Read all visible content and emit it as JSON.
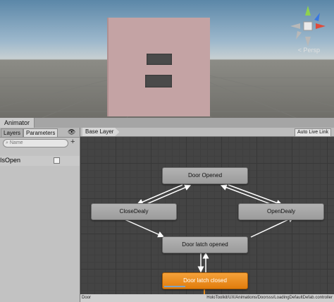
{
  "scene": {
    "persp_label": "< Persp"
  },
  "animator": {
    "window_title": "Animator",
    "left_tabs": [
      "Layers",
      "Parameters"
    ],
    "eye_icon": "eye-icon",
    "search_placeholder": "Name",
    "add_label": "+",
    "parameters": [
      {
        "name": "IsOpen",
        "type": "bool",
        "value": false
      }
    ],
    "layer_breadcrumb": "Base Layer",
    "auto_live_link": "Auto Live Link",
    "states": [
      "Door Opened",
      "CloseDealy",
      "OpenDealy",
      "Door latch opened",
      "Door latch closed"
    ],
    "default_state": "Door latch closed",
    "status_left": "Door",
    "status_right": "HoloToolkit/UX/Animations/Doorsss/LoadingDefaultDefab.controller"
  }
}
